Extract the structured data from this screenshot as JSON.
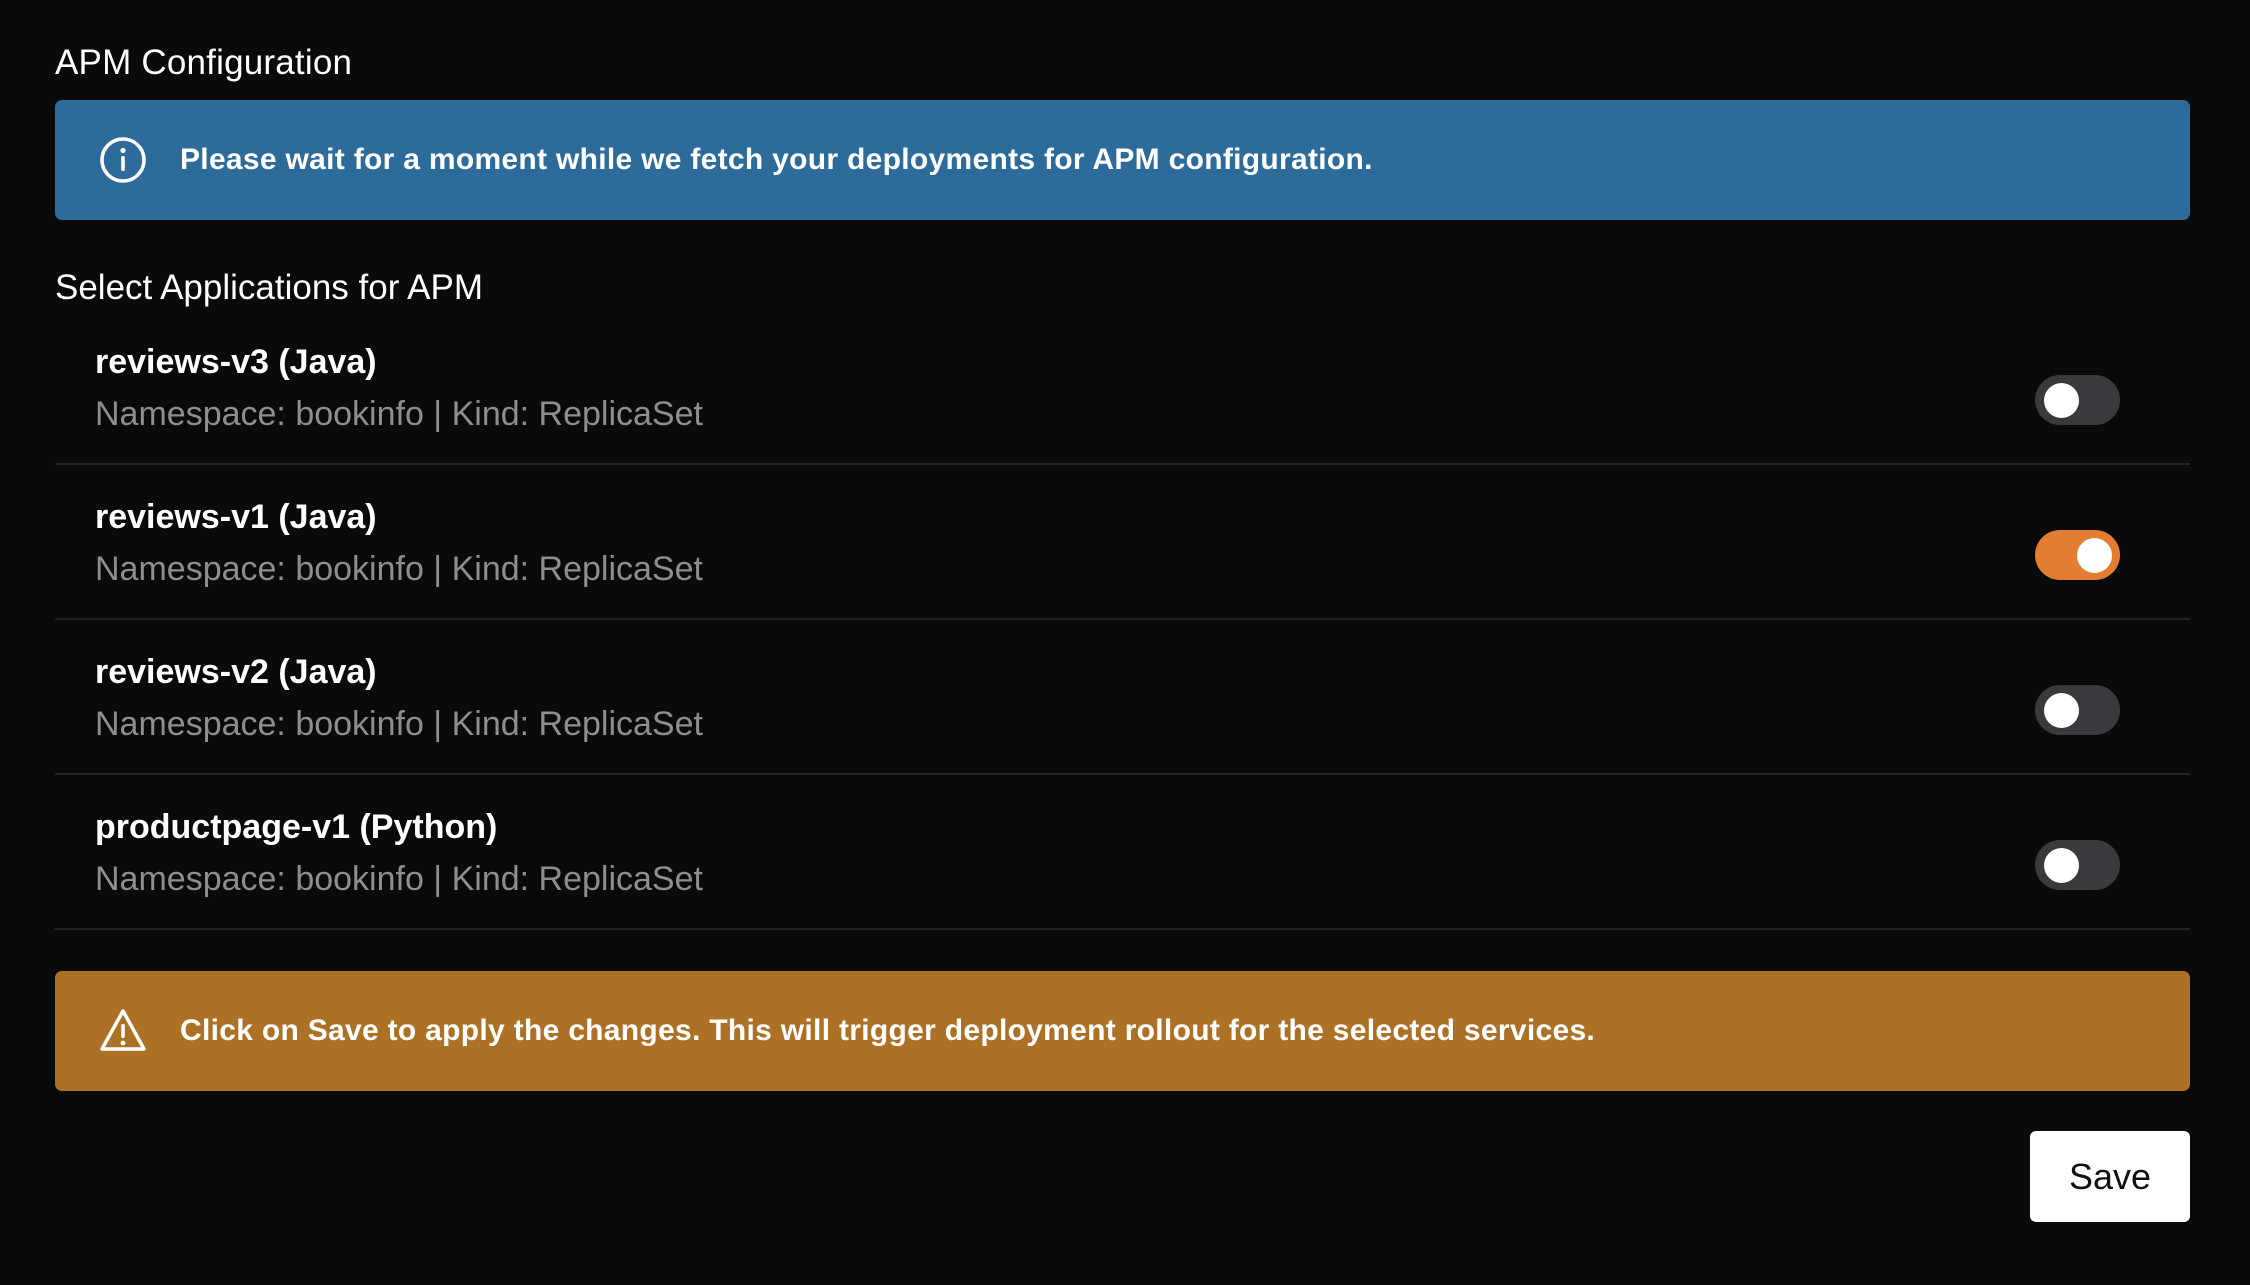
{
  "page": {
    "title": "APM Configuration"
  },
  "info_banner": {
    "icon": "info-circle-icon",
    "message": "Please wait for a moment while we fetch your deployments for APM configuration.",
    "color": "#2d6b9b"
  },
  "applications": {
    "section_title": "Select Applications for APM",
    "items": [
      {
        "name": "reviews-v3 (Java)",
        "meta": "Namespace: bookinfo | Kind: ReplicaSet",
        "enabled": false
      },
      {
        "name": "reviews-v1 (Java)",
        "meta": "Namespace: bookinfo | Kind: ReplicaSet",
        "enabled": true
      },
      {
        "name": "reviews-v2 (Java)",
        "meta": "Namespace: bookinfo | Kind: ReplicaSet",
        "enabled": false
      },
      {
        "name": "productpage-v1 (Python)",
        "meta": "Namespace: bookinfo | Kind: ReplicaSet",
        "enabled": false
      }
    ]
  },
  "warning_banner": {
    "icon": "warning-triangle-icon",
    "message": "Click on Save to apply the changes. This will trigger deployment rollout for the selected services.",
    "color": "#ad7126"
  },
  "actions": {
    "save_label": "Save"
  },
  "colors": {
    "background": "#0a0a0b",
    "toggle_on": "#e27d32",
    "toggle_off": "#3a3a3e"
  }
}
